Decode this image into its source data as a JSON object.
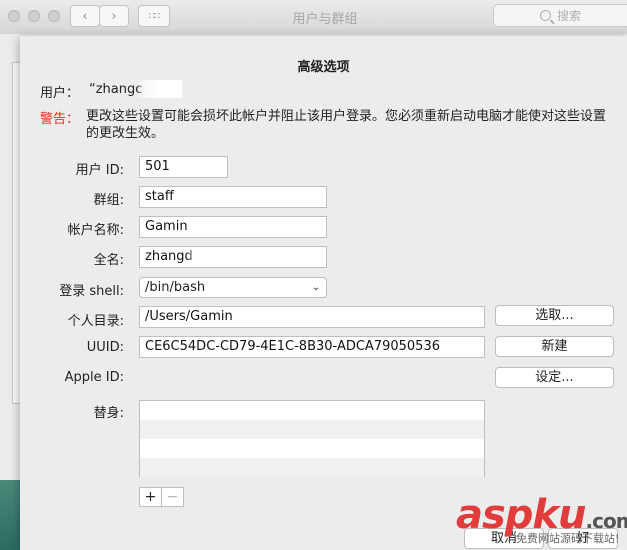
{
  "window": {
    "title": "用户与群组",
    "search_placeholder": "搜索"
  },
  "sheet": {
    "title": "高级选项",
    "user_label": "用户：",
    "user_value": "“zhangc",
    "warning_label": "警告：",
    "warning_text": "更改这些设置可能会损坏此帐户并阻止该用户登录。您必须重新启动电脑才能使对这些设置的更改生效。",
    "fields": {
      "user_id_label": "用户 ID:",
      "user_id_value": "501",
      "group_label": "群组:",
      "group_value": "staff",
      "account_label": "帐户名称:",
      "account_value": "Gamin",
      "fullname_label": "全名:",
      "fullname_value": "zhangd",
      "shell_label": "登录 shell:",
      "shell_value": "/bin/bash",
      "home_label": "个人目录:",
      "home_value": "/Users/Gamin",
      "uuid_label": "UUID:",
      "uuid_value": "CE6C54DC-CD79-4E1C-8B30-ADCA79050536",
      "appleid_label": "Apple ID:",
      "aliases_label": "替身:"
    },
    "buttons": {
      "choose": "选取...",
      "create": "新建",
      "set": "设定...",
      "cancel": "取消",
      "ok": "好"
    },
    "list_controls": {
      "add": "+",
      "remove": "−"
    }
  },
  "watermark": {
    "text": "aspku",
    "suffix": ".com",
    "sub": "免费网站源码下载站!"
  },
  "colors": {
    "warning": "#e0301e",
    "sheet_bg": "#ececec",
    "watermark": "#e23b3b"
  }
}
